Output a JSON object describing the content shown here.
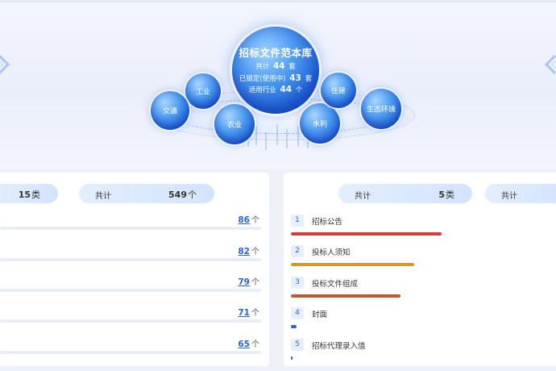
{
  "hero": {
    "title": "招标文件范本库",
    "total_label": "共计",
    "total_value": "44",
    "total_unit": "套",
    "locked_label": "已锁定(使用中)",
    "locked_value": "43",
    "locked_unit": "套",
    "industry_label": "适用行业",
    "industry_value": "44",
    "industry_unit": "个",
    "categories": [
      {
        "label": "工业"
      },
      {
        "label": "交通"
      },
      {
        "label": "农业"
      },
      {
        "label": "水利"
      },
      {
        "label": "住建"
      },
      {
        "label": "生态环境"
      }
    ]
  },
  "left_panel": {
    "pill1_value": "15",
    "pill1_unit": "类",
    "pill2_label": "共计",
    "pill2_value": "549",
    "pill2_unit": "个",
    "rows": [
      {
        "value": "86",
        "unit": "个"
      },
      {
        "value": "82",
        "unit": "个"
      },
      {
        "value": "79",
        "unit": "个"
      },
      {
        "value": "71",
        "unit": "个"
      },
      {
        "value": "65",
        "unit": "个"
      }
    ]
  },
  "right_panel": {
    "pill1_label": "共计",
    "pill1_value": "5",
    "pill1_unit": "类",
    "pill2_label": "共计",
    "rows": [
      {
        "index": "1",
        "name": "招标公告",
        "progress": 0.55,
        "color": "#d83a3a"
      },
      {
        "index": "2",
        "name": "投标人须知",
        "progress": 0.45,
        "color": "#d4962e"
      },
      {
        "index": "3",
        "name": "投标文件组成",
        "progress": 0.4,
        "color": "#c2592d"
      },
      {
        "index": "4",
        "name": "封面",
        "progress": 0.02,
        "color": "#2a64d6"
      },
      {
        "index": "5",
        "name": "招标代理录入值",
        "progress": 0.005,
        "color": "#2a64d6"
      }
    ]
  },
  "colors": {
    "accent": "#2a64d6",
    "sphere": "#1f62d8"
  }
}
